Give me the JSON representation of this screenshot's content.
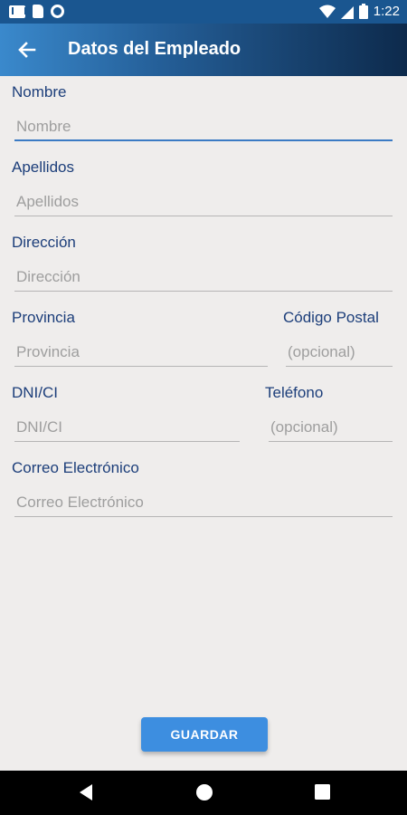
{
  "status_bar": {
    "time": "1:22",
    "left_icons": [
      "gmail-icon",
      "sd-card-icon",
      "circle-icon"
    ],
    "right_icons": [
      "wifi-icon",
      "signal-icon",
      "battery-icon"
    ]
  },
  "app_bar": {
    "title": "Datos del Empleado",
    "back_icon": "arrow-left-icon",
    "gradient_colors": [
      "#3a89cc",
      "#245e97",
      "#0d2a4c"
    ]
  },
  "form": {
    "nombre": {
      "label": "Nombre",
      "placeholder": "Nombre",
      "value": ""
    },
    "apellidos": {
      "label": "Apellidos",
      "placeholder": "Apellidos",
      "value": ""
    },
    "direccion": {
      "label": "Dirección",
      "placeholder": "Dirección",
      "value": ""
    },
    "provincia": {
      "label": "Provincia",
      "placeholder": "Provincia",
      "value": ""
    },
    "codigo_postal": {
      "label": "Código Postal",
      "placeholder": "(opcional)",
      "value": ""
    },
    "dni": {
      "label": "DNI/CI",
      "placeholder": "DNI/CI",
      "value": ""
    },
    "telefono": {
      "label": "Teléfono",
      "placeholder": "(opcional)",
      "value": ""
    },
    "correo": {
      "label": "Correo Electrónico",
      "placeholder": "Correo Electrónico",
      "value": ""
    }
  },
  "save_button": {
    "label": "GUARDAR"
  },
  "nav_bar": {
    "icons": [
      "back-triangle-icon",
      "home-circle-icon",
      "recents-square-icon"
    ]
  },
  "colors": {
    "label": "#1c3e7a",
    "accent": "#3b7bc4",
    "button": "#3d8ee0",
    "background": "#efedec"
  }
}
